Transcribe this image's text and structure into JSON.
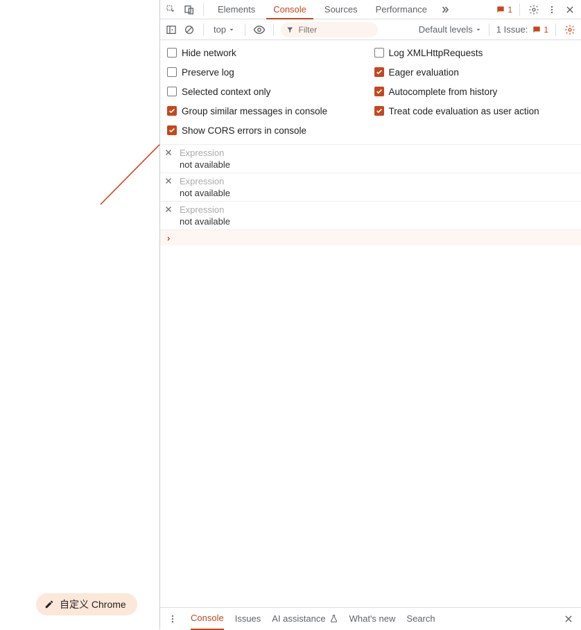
{
  "customize_button": "自定义 Chrome",
  "top_tabs": {
    "elements": "Elements",
    "console": "Console",
    "sources": "Sources",
    "performance": "Performance",
    "errors_badge": "1"
  },
  "toolbar": {
    "context": "top",
    "filter_placeholder": "Filter",
    "levels": "Default levels",
    "issue_label": "1 Issue:",
    "issue_count": "1"
  },
  "settings": {
    "left": [
      {
        "label": "Hide network",
        "checked": false
      },
      {
        "label": "Preserve log",
        "checked": false
      },
      {
        "label": "Selected context only",
        "checked": false
      },
      {
        "label": "Group similar messages in console",
        "checked": true
      },
      {
        "label": "Show CORS errors in console",
        "checked": true
      }
    ],
    "right": [
      {
        "label": "Log XMLHttpRequests",
        "checked": false
      },
      {
        "label": "Eager evaluation",
        "checked": true
      },
      {
        "label": "Autocomplete from history",
        "checked": true
      },
      {
        "label": "Treat code evaluation as user action",
        "checked": true
      }
    ]
  },
  "expressions": [
    {
      "placeholder": "Expression",
      "result": "not available"
    },
    {
      "placeholder": "Expression",
      "result": "not available"
    },
    {
      "placeholder": "Expression",
      "result": "not available"
    }
  ],
  "drawer": {
    "console": "Console",
    "issues": "Issues",
    "ai": "AI assistance",
    "whatsnew": "What's new",
    "search": "Search"
  }
}
